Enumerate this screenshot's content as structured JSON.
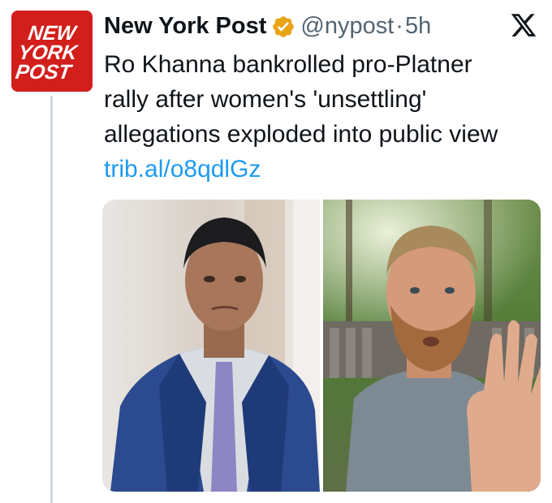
{
  "account": {
    "name": "New York Post",
    "handle": "@nypost",
    "separator": "·",
    "time": "5h",
    "verified": true,
    "avatar_text": [
      "NEW",
      "YORK",
      "POST"
    ],
    "avatar_color": "#d21f1b"
  },
  "tweet": {
    "lines": [
      "Ro Khanna bankrolled pro-Platner",
      "rally after women's 'unsettling'",
      "allegations exploded into public view"
    ],
    "link": "trib.al/o8qdlGz"
  },
  "icons": {
    "verified": "verified-badge-icon",
    "platform": "x-logo-icon"
  },
  "colors": {
    "link": "#1d9bf0",
    "secondary_text": "#536471",
    "verified_badge": "#e8a317",
    "thread_line": "#cfd9de"
  }
}
